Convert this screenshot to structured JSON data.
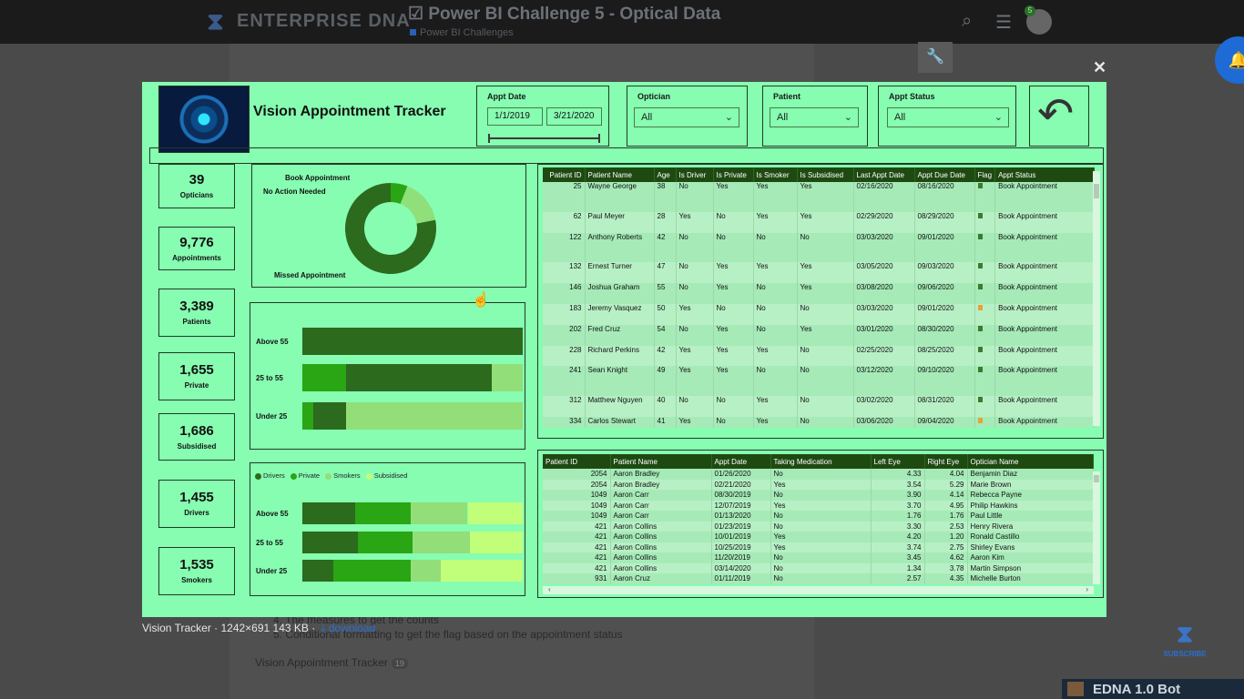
{
  "forum": {
    "brand": "ENTERPRISE DNA",
    "title": "Power BI Challenge 5 - Optical Data",
    "breadcrumb": "Power BI Challenges",
    "notif_count": "5",
    "bg_line1": "4. The measures to get the counts",
    "bg_line2": "5. Conditional formatting to get the flag based on the appointment status",
    "bg_link": "Vision Appointment Tracker",
    "bg_link_count": "19",
    "subscribe": "SUBSCRIBE",
    "bot": "EDNA 1.0 Bot"
  },
  "lightbox": {
    "caption": "Vision Tracker · 1242×691 143 KB ·",
    "download": "download"
  },
  "dashboard": {
    "title": "Vision Appointment Tracker",
    "slicers": {
      "date_label": "Appt Date",
      "date_from": "1/1/2019",
      "date_to": "3/21/2020",
      "optician_label": "Optician",
      "optician_value": "All",
      "patient_label": "Patient",
      "patient_value": "All",
      "status_label": "Appt Status",
      "status_value": "All"
    },
    "kpis": [
      {
        "value": "39",
        "label": "Opticians"
      },
      {
        "value": "9,776",
        "label": "Appointments"
      },
      {
        "value": "3,389",
        "label": "Patients"
      },
      {
        "value": "1,655",
        "label": "Private"
      },
      {
        "value": "1,686",
        "label": "Subsidised"
      },
      {
        "value": "1,455",
        "label": "Drivers"
      },
      {
        "value": "1,535",
        "label": "Smokers"
      }
    ],
    "donut": {
      "labels": [
        "Book Appointment",
        "No Action Needed",
        "Missed Appointment"
      ],
      "values": [
        6,
        16,
        78
      ],
      "colors": [
        "#2aa514",
        "#8fe07a",
        "#2c6a1e"
      ]
    },
    "age_bars": {
      "categories": [
        "Above 55",
        "25 to 55",
        "Under 25"
      ],
      "segments": [
        [
          100,
          0,
          0
        ],
        [
          20,
          66,
          14
        ],
        [
          5,
          15,
          80
        ]
      ],
      "colors": [
        "#2c6a1e",
        "#2aa514",
        "#92de78"
      ],
      "second_colors": [
        "#2aa514",
        "#2c6a1e",
        "#92de78"
      ]
    },
    "stacked_bars": {
      "legend": [
        "Drivers",
        "Private",
        "Smokers",
        "Subsidised"
      ],
      "legend_colors": [
        "#2c6a1e",
        "#2aa514",
        "#92de78",
        "#c1ff7a"
      ],
      "categories": [
        "Above 55",
        "25 to 55",
        "Under 25"
      ],
      "series": [
        [
          24,
          25,
          26,
          25
        ],
        [
          25,
          25,
          26,
          24
        ],
        [
          14,
          35,
          14,
          37
        ]
      ]
    }
  },
  "table1": {
    "headers": [
      "Patient ID",
      "Patient Name",
      "Age",
      "Is Driver",
      "Is Private",
      "Is Smoker",
      "Is Subsidised",
      "Last Appt Date",
      "Appt Due Date",
      "Flag",
      "Appt Status"
    ],
    "rows": [
      [
        "25",
        "Wayne George",
        "38",
        "No",
        "Yes",
        "Yes",
        "Yes",
        "02/16/2020",
        "08/16/2020",
        "Book Appointment"
      ],
      [
        "62",
        "Paul Meyer",
        "28",
        "Yes",
        "No",
        "Yes",
        "Yes",
        "02/29/2020",
        "08/29/2020",
        "Book Appointment"
      ],
      [
        "122",
        "Anthony Roberts",
        "42",
        "No",
        "No",
        "No",
        "No",
        "03/03/2020",
        "09/01/2020",
        "Book Appointment"
      ],
      [
        "132",
        "Ernest Turner",
        "47",
        "No",
        "Yes",
        "Yes",
        "Yes",
        "03/05/2020",
        "09/03/2020",
        "Book Appointment"
      ],
      [
        "146",
        "Joshua Graham",
        "55",
        "No",
        "Yes",
        "No",
        "Yes",
        "03/08/2020",
        "09/06/2020",
        "Book Appointment"
      ],
      [
        "183",
        "Jeremy Vasquez",
        "50",
        "Yes",
        "No",
        "No",
        "No",
        "03/03/2020",
        "09/01/2020",
        "Book Appointment"
      ],
      [
        "202",
        "Fred Cruz",
        "54",
        "No",
        "Yes",
        "No",
        "Yes",
        "03/01/2020",
        "08/30/2020",
        "Book Appointment"
      ],
      [
        "228",
        "Richard Perkins",
        "42",
        "Yes",
        "Yes",
        "Yes",
        "No",
        "02/25/2020",
        "08/25/2020",
        "Book Appointment"
      ],
      [
        "241",
        "Sean Knight",
        "49",
        "Yes",
        "Yes",
        "No",
        "No",
        "03/12/2020",
        "09/10/2020",
        "Book Appointment"
      ],
      [
        "312",
        "Matthew Nguyen",
        "40",
        "No",
        "No",
        "Yes",
        "No",
        "03/02/2020",
        "08/31/2020",
        "Book Appointment"
      ],
      [
        "334",
        "Carlos Stewart",
        "41",
        "Yes",
        "No",
        "Yes",
        "No",
        "03/06/2020",
        "09/04/2020",
        "Book Appointment"
      ]
    ]
  },
  "table2": {
    "headers": [
      "Patient ID",
      "Patient Name",
      "Appt Date",
      "Taking Medication",
      "Left Eye",
      "Right Eye",
      "Optician Name"
    ],
    "rows": [
      [
        "2054",
        "Aaron Bradley",
        "01/26/2020",
        "No",
        "4.33",
        "4.04",
        "Benjamin Diaz"
      ],
      [
        "2054",
        "Aaron Bradley",
        "02/21/2020",
        "Yes",
        "3.54",
        "5.29",
        "Marie Brown"
      ],
      [
        "1049",
        "Aaron Carr",
        "08/30/2019",
        "No",
        "3.90",
        "4.14",
        "Rebecca Payne"
      ],
      [
        "1049",
        "Aaron Carr",
        "12/07/2019",
        "Yes",
        "3.70",
        "4.95",
        "Philip Hawkins"
      ],
      [
        "1049",
        "Aaron Carr",
        "01/13/2020",
        "No",
        "1.76",
        "1.76",
        "Paul Little"
      ],
      [
        "421",
        "Aaron Collins",
        "01/23/2019",
        "No",
        "3.30",
        "2.53",
        "Henry Rivera"
      ],
      [
        "421",
        "Aaron Collins",
        "10/01/2019",
        "Yes",
        "4.20",
        "1.20",
        "Ronald Castillo"
      ],
      [
        "421",
        "Aaron Collins",
        "10/25/2019",
        "Yes",
        "3.74",
        "2.75",
        "Shirley Evans"
      ],
      [
        "421",
        "Aaron Collins",
        "11/20/2019",
        "No",
        "3.45",
        "4.62",
        "Aaron Kim"
      ],
      [
        "421",
        "Aaron Collins",
        "03/14/2020",
        "No",
        "1.34",
        "3.78",
        "Martin Simpson"
      ],
      [
        "931",
        "Aaron Cruz",
        "01/11/2019",
        "No",
        "2.57",
        "4.35",
        "Michelle Burton"
      ]
    ]
  }
}
